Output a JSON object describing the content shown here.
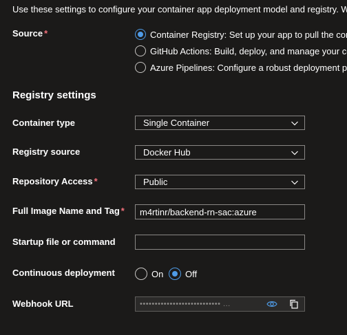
{
  "intro": "Use these settings to configure your container app deployment model and registry. We r",
  "source": {
    "label": "Source",
    "options": [
      {
        "label": "Container Registry: Set up your app to pull the cont",
        "selected": true
      },
      {
        "label": "GitHub Actions: Build, deploy, and manage your co",
        "selected": false
      },
      {
        "label": "Azure Pipelines: Configure a robust deployment pip",
        "selected": false
      }
    ]
  },
  "registry": {
    "title": "Registry settings",
    "container_type": {
      "label": "Container type",
      "value": "Single Container"
    },
    "registry_source": {
      "label": "Registry source",
      "value": "Docker Hub"
    },
    "repository_access": {
      "label": "Repository Access",
      "value": "Public"
    },
    "image": {
      "label": "Full Image Name and Tag",
      "value": "m4rtinr/backend-rn-sac:azure"
    },
    "startup": {
      "label": "Startup file or command",
      "value": ""
    },
    "continuous": {
      "label": "Continuous deployment",
      "on_label": "On",
      "off_label": "Off",
      "selected": "Off"
    },
    "webhook": {
      "label": "Webhook URL",
      "masked": "••••••••••••••••••••••••••• ..."
    }
  },
  "colors": {
    "accent": "#4f9be6",
    "required": "#f1707b",
    "background": "#1b1a19",
    "border": "#8a8886"
  }
}
